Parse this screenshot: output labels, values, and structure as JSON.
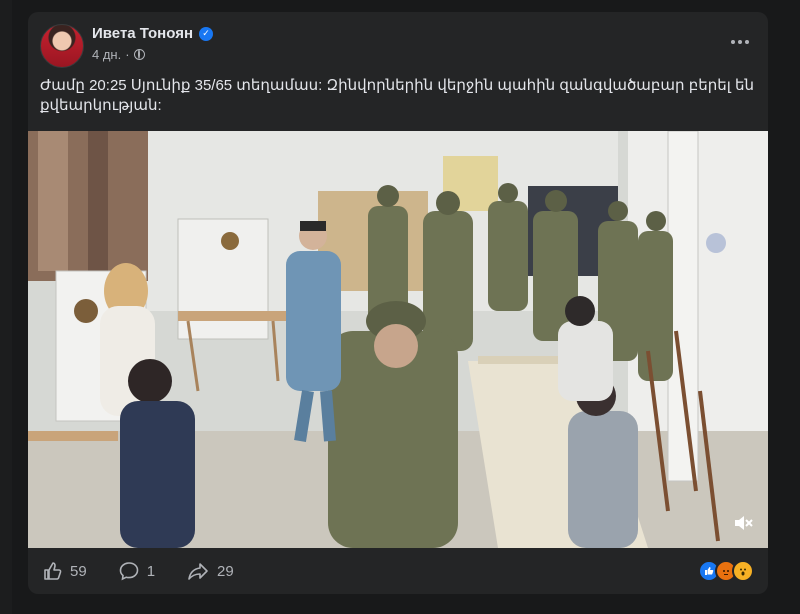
{
  "post": {
    "author": "Ивета Тоноян",
    "time": "4 дн.",
    "separator": "·",
    "text": "Ժամը 20:25 Սյունիք 35/65 տեղամաս: Զինվորներին վերջին պահին զանգվածաբար բերել են քվեարկության:"
  },
  "icons": {
    "verified": "verified-badge-icon",
    "privacy": "globe-icon",
    "menu": "more-horizontal-icon",
    "mute": "speaker-muted-icon",
    "like": "thumbs-up-icon",
    "comment": "comment-bubble-icon",
    "share": "share-arrow-icon"
  },
  "counts": {
    "likes": "59",
    "comments": "1",
    "shares": "29"
  },
  "reactions": [
    "like",
    "angry",
    "wow"
  ],
  "colors": {
    "background": "#18191a",
    "card": "#242526",
    "text": "#e4e6eb",
    "secondary": "#b0b3b8",
    "verified": "#1877f2"
  }
}
